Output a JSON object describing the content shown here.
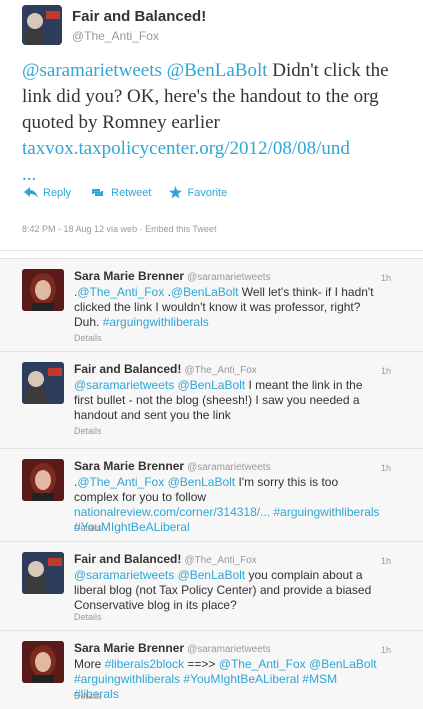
{
  "main": {
    "name": "Fair and Balanced!",
    "handle": "@The_Anti_Fox",
    "mention1": "@saramarietweets",
    "mention2": "@BenLaBolt",
    "text": " Didn't click the link did you? OK, here's the handout to the org quoted by Romney earlier ",
    "link": "taxvox.taxpolicycenter.org/2012/08/08/und",
    "ellipsis": "...",
    "reply_label": "Reply",
    "retweet_label": "Retweet",
    "favorite_label": "Favorite",
    "meta": "8:42 PM - 18 Aug 12 via web · Embed this Tweet"
  },
  "replies": [
    {
      "name": "Sara Marie Brenner",
      "handle": "@saramarietweets",
      "time": "1h",
      "parts": [
        {
          "t": ".",
          "c": "text"
        },
        {
          "t": "@The_Anti_Fox",
          "c": "link"
        },
        {
          "t": " .",
          "c": "text"
        },
        {
          "t": "@BenLaBolt",
          "c": "link"
        },
        {
          "t": " Well let's think- if I hadn't clicked the link I wouldn't know it was professor, right? Duh. ",
          "c": "text"
        },
        {
          "t": "#arguingwithliberals",
          "c": "link"
        }
      ],
      "details": "Details"
    },
    {
      "name": "Fair and Balanced!",
      "handle": "@The_Anti_Fox",
      "time": "1h",
      "parts": [
        {
          "t": "@saramarietweets",
          "c": "link"
        },
        {
          "t": " ",
          "c": "text"
        },
        {
          "t": "@BenLaBolt",
          "c": "link"
        },
        {
          "t": " I meant the link in the first bullet - not the blog (sheesh!) I saw you needed a handout and sent you the link",
          "c": "text"
        }
      ],
      "details": "Details"
    },
    {
      "name": "Sara Marie Brenner",
      "handle": "@saramarietweets",
      "time": "1h",
      "parts": [
        {
          "t": ".",
          "c": "text"
        },
        {
          "t": "@The_Anti_Fox",
          "c": "link"
        },
        {
          "t": " ",
          "c": "text"
        },
        {
          "t": "@BenLaBolt",
          "c": "link"
        },
        {
          "t": " I'm sorry this is too complex for you to follow ",
          "c": "text"
        },
        {
          "t": "nationalreview.com/corner/314318/...",
          "c": "link"
        },
        {
          "t": " ",
          "c": "text"
        },
        {
          "t": "#arguingwithliberals",
          "c": "link"
        },
        {
          "t": " ",
          "c": "text"
        },
        {
          "t": "#YouMIghtBeALiberal",
          "c": "link"
        }
      ],
      "details": "Details"
    },
    {
      "name": "Fair and Balanced!",
      "handle": "@The_Anti_Fox",
      "time": "1h",
      "parts": [
        {
          "t": "@saramarietweets",
          "c": "link"
        },
        {
          "t": " ",
          "c": "text"
        },
        {
          "t": "@BenLaBolt",
          "c": "link"
        },
        {
          "t": " you complain about a liberal blog (not Tax Policy Center) and provide a biased Conservative blog in its place?",
          "c": "text"
        }
      ],
      "details": "Details"
    },
    {
      "name": "Sara Marie Brenner",
      "handle": "@saramarietweets",
      "time": "1h",
      "parts": [
        {
          "t": "More ",
          "c": "text"
        },
        {
          "t": "#liberals2block",
          "c": "link"
        },
        {
          "t": " ==>> ",
          "c": "text"
        },
        {
          "t": "@The_Anti_Fox",
          "c": "link"
        },
        {
          "t": " ",
          "c": "text"
        },
        {
          "t": "@BenLaBolt",
          "c": "link"
        },
        {
          "t": " ",
          "c": "text"
        },
        {
          "t": "#arguingwithliberals",
          "c": "link"
        },
        {
          "t": " ",
          "c": "text"
        },
        {
          "t": "#YouMIghtBeALiberal",
          "c": "link"
        },
        {
          "t": " ",
          "c": "text"
        },
        {
          "t": "#MSM",
          "c": "link"
        },
        {
          "t": " ",
          "c": "text"
        },
        {
          "t": "#liberals",
          "c": "link"
        }
      ],
      "details": "Details"
    }
  ],
  "colors": {
    "link": "#2fa6d8",
    "text": "#333333",
    "muted": "#999999"
  }
}
